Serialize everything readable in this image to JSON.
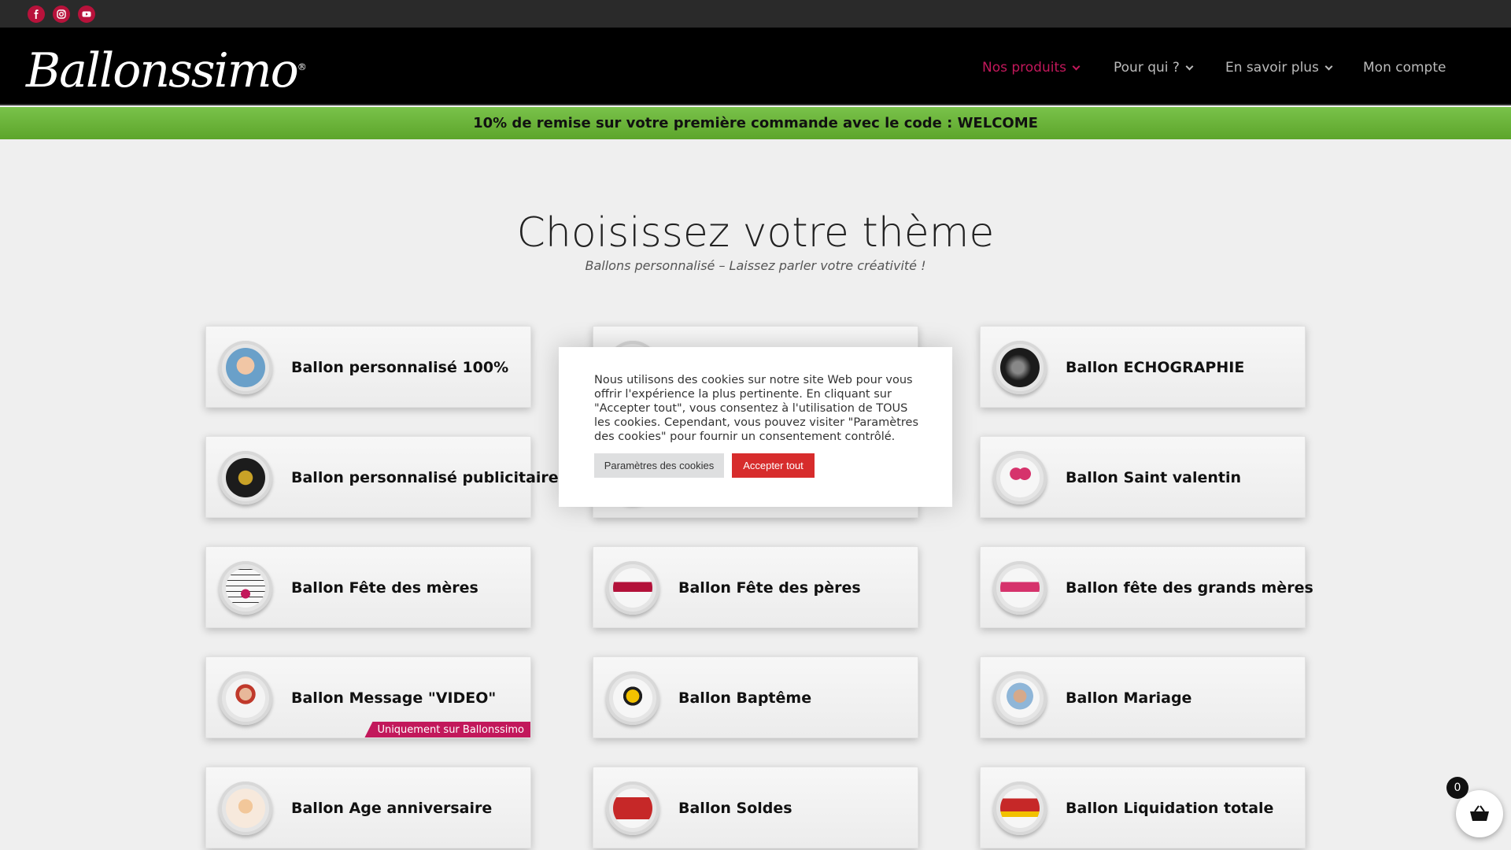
{
  "topbar": {
    "social": [
      {
        "name": "facebook-icon"
      },
      {
        "name": "instagram-icon"
      },
      {
        "name": "youtube-icon"
      }
    ]
  },
  "header": {
    "logo": "Ballonssimo",
    "logo_mark": "®",
    "nav": [
      {
        "label": "Nos produits",
        "active": true,
        "dropdown": true
      },
      {
        "label": "Pour qui ?",
        "active": false,
        "dropdown": true
      },
      {
        "label": "En savoir plus",
        "active": false,
        "dropdown": true
      },
      {
        "label": "Mon compte",
        "active": false,
        "dropdown": false
      }
    ]
  },
  "promo": {
    "text": "10% de remise sur votre première commande avec le code : WELCOME"
  },
  "main": {
    "title": "Choisissez votre thème",
    "subtitle": "Ballons personnalisé – Laissez parler votre créativité !",
    "themes": [
      {
        "label": "Ballon personnalisé 100%"
      },
      {
        "label": ""
      },
      {
        "label": "Ballon ECHOGRAPHIE"
      },
      {
        "label": "Ballon personnalisé publicitaire"
      },
      {
        "label": ""
      },
      {
        "label": "Ballon Saint valentin"
      },
      {
        "label": "Ballon Fête des mères"
      },
      {
        "label": "Ballon Fête des pères"
      },
      {
        "label": "Ballon fête des grands mères"
      },
      {
        "label": "Ballon Message \"VIDEO\"",
        "badge": "Uniquement sur Ballonssimo"
      },
      {
        "label": "Ballon Baptême"
      },
      {
        "label": "Ballon Mariage"
      },
      {
        "label": "Ballon Age anniversaire"
      },
      {
        "label": "Ballon Soldes"
      },
      {
        "label": "Ballon Liquidation totale"
      }
    ]
  },
  "cookie": {
    "text": "Nous utilisons des cookies sur notre site Web pour vous offrir l'expérience la plus pertinente. En cliquant sur \"Accepter tout\", vous consentez à l'utilisation de TOUS les cookies. Cependant, vous pouvez visiter \"Paramètres des cookies\" pour fournir un consentement contrôlé.",
    "settings_label": "Paramètres des cookies",
    "accept_label": "Accepter tout"
  },
  "cart": {
    "count": "0"
  },
  "colors": {
    "accent": "#c2185b",
    "promo_green": "#6db33f",
    "accept_red": "#d72c2c",
    "header_bg": "#000000"
  }
}
